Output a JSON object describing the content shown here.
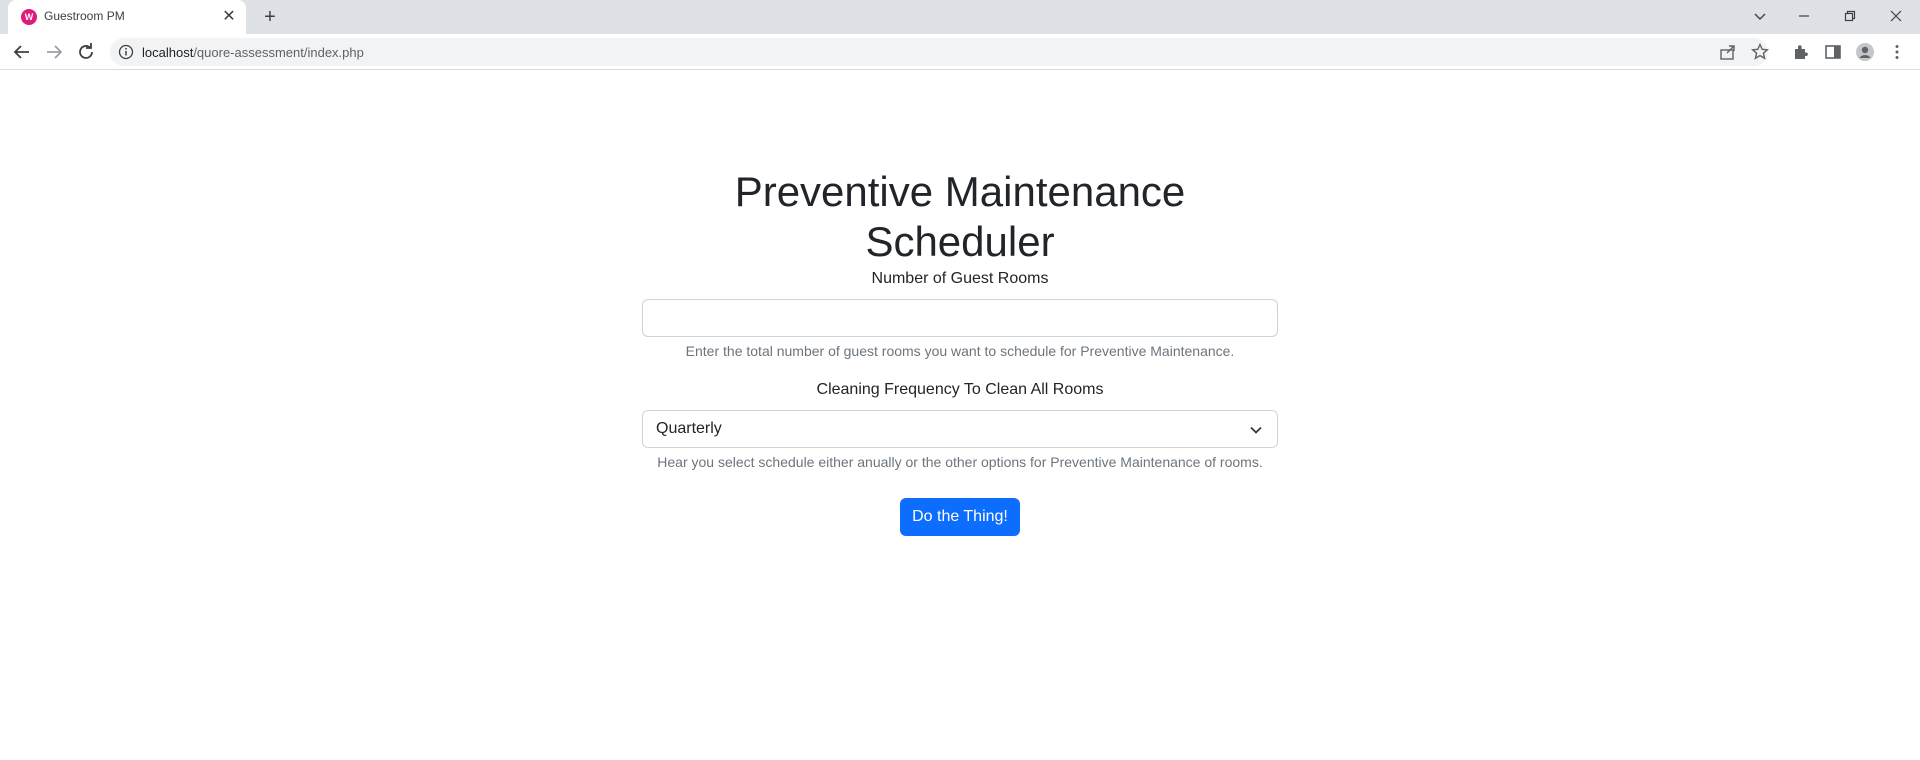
{
  "browser": {
    "tab_title": "Guestroom PM",
    "favicon_letter": "W",
    "url_host": "localhost",
    "url_path": "/quore-assessment/index.php",
    "tab_close": "✕",
    "new_tab": "+"
  },
  "page": {
    "title": "Preventive Maintenance Scheduler",
    "rooms_label": "Number of Guest Rooms",
    "rooms_value": "",
    "rooms_help": "Enter the total number of guest rooms you want to schedule for Preventive Maintenance.",
    "frequency_label": "Cleaning Frequency To Clean All Rooms",
    "frequency_selected": "Quarterly",
    "frequency_help": "Hear you select schedule either anually or the other options for Preventive Maintenance of rooms.",
    "submit_label": "Do the Thing!"
  },
  "colors": {
    "accent": "#0d6efd",
    "tab_favicon": "#e0197d"
  }
}
